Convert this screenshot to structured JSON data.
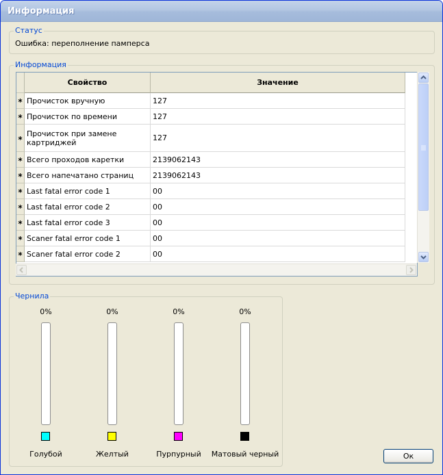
{
  "window": {
    "title": "Информация"
  },
  "status": {
    "legend": "Статус",
    "text": "Ошибка: переполнение памперса"
  },
  "info": {
    "legend": "Информация",
    "columns": [
      "Свойство",
      "Значение"
    ],
    "rows": [
      {
        "marker": "*",
        "property": "Прочисток вручную",
        "value": "127"
      },
      {
        "marker": "*",
        "property": "Прочисток по времени",
        "value": "127"
      },
      {
        "marker": "*",
        "property": "Прочисток при замене картриджей",
        "value": "127"
      },
      {
        "marker": "*",
        "property": "Всего проходов каретки",
        "value": "2139062143"
      },
      {
        "marker": "*",
        "property": "Всего напечатано страниц",
        "value": "2139062143"
      },
      {
        "marker": "*",
        "property": "Last fatal error code 1",
        "value": "00"
      },
      {
        "marker": "*",
        "property": "Last fatal error code 2",
        "value": "00"
      },
      {
        "marker": "*",
        "property": "Last fatal error code 3",
        "value": "00"
      },
      {
        "marker": "*",
        "property": "Scaner fatal error code 1",
        "value": "00"
      },
      {
        "marker": "*",
        "property": "Scaner fatal error code 2",
        "value": "00"
      }
    ]
  },
  "ink": {
    "legend": "Чернила",
    "items": [
      {
        "name": "Голубой",
        "level": "0%",
        "fill": 0,
        "color": "#00ffff"
      },
      {
        "name": "Желтый",
        "level": "0%",
        "fill": 0,
        "color": "#ffff00"
      },
      {
        "name": "Пурпурный",
        "level": "0%",
        "fill": 0,
        "color": "#ff00ff"
      },
      {
        "name": "Матовый черный",
        "level": "0%",
        "fill": 0,
        "color": "#000000"
      }
    ]
  },
  "buttons": {
    "ok": "Ок"
  }
}
